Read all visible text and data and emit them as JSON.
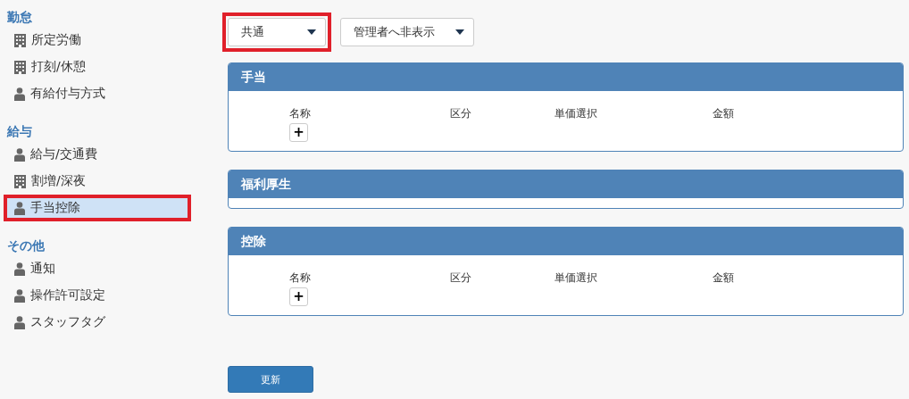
{
  "sidebar": {
    "sections": [
      {
        "title": "勤怠",
        "items": [
          {
            "label": "所定労働",
            "kind": "building",
            "selected": false,
            "highlighted": false
          },
          {
            "label": "打刻/休憩",
            "kind": "building",
            "selected": false,
            "highlighted": false
          },
          {
            "label": "有給付与方式",
            "kind": "person",
            "selected": false,
            "highlighted": false
          }
        ]
      },
      {
        "title": "給与",
        "items": [
          {
            "label": "給与/交通費",
            "kind": "person",
            "selected": false,
            "highlighted": false
          },
          {
            "label": "割増/深夜",
            "kind": "building",
            "selected": false,
            "highlighted": false
          },
          {
            "label": "手当控除",
            "kind": "person",
            "selected": true,
            "highlighted": true
          }
        ]
      },
      {
        "title": "その他",
        "items": [
          {
            "label": "通知",
            "kind": "person",
            "selected": false,
            "highlighted": false
          },
          {
            "label": "操作許可設定",
            "kind": "person",
            "selected": false,
            "highlighted": false
          },
          {
            "label": "スタッフタグ",
            "kind": "person",
            "selected": false,
            "highlighted": false
          }
        ]
      }
    ]
  },
  "filters": [
    {
      "value": "共通",
      "highlighted": true
    },
    {
      "value": "管理者へ非表示",
      "highlighted": false
    }
  ],
  "panels": [
    {
      "title": "手当",
      "columns": [
        "名称",
        "区分",
        "単価選択",
        "金額"
      ],
      "add_button": "+"
    },
    {
      "title": "福利厚生"
    },
    {
      "title": "控除",
      "columns": [
        "名称",
        "区分",
        "単価選択",
        "金額"
      ],
      "add_button": "+"
    }
  ],
  "submit_button": "更新"
}
